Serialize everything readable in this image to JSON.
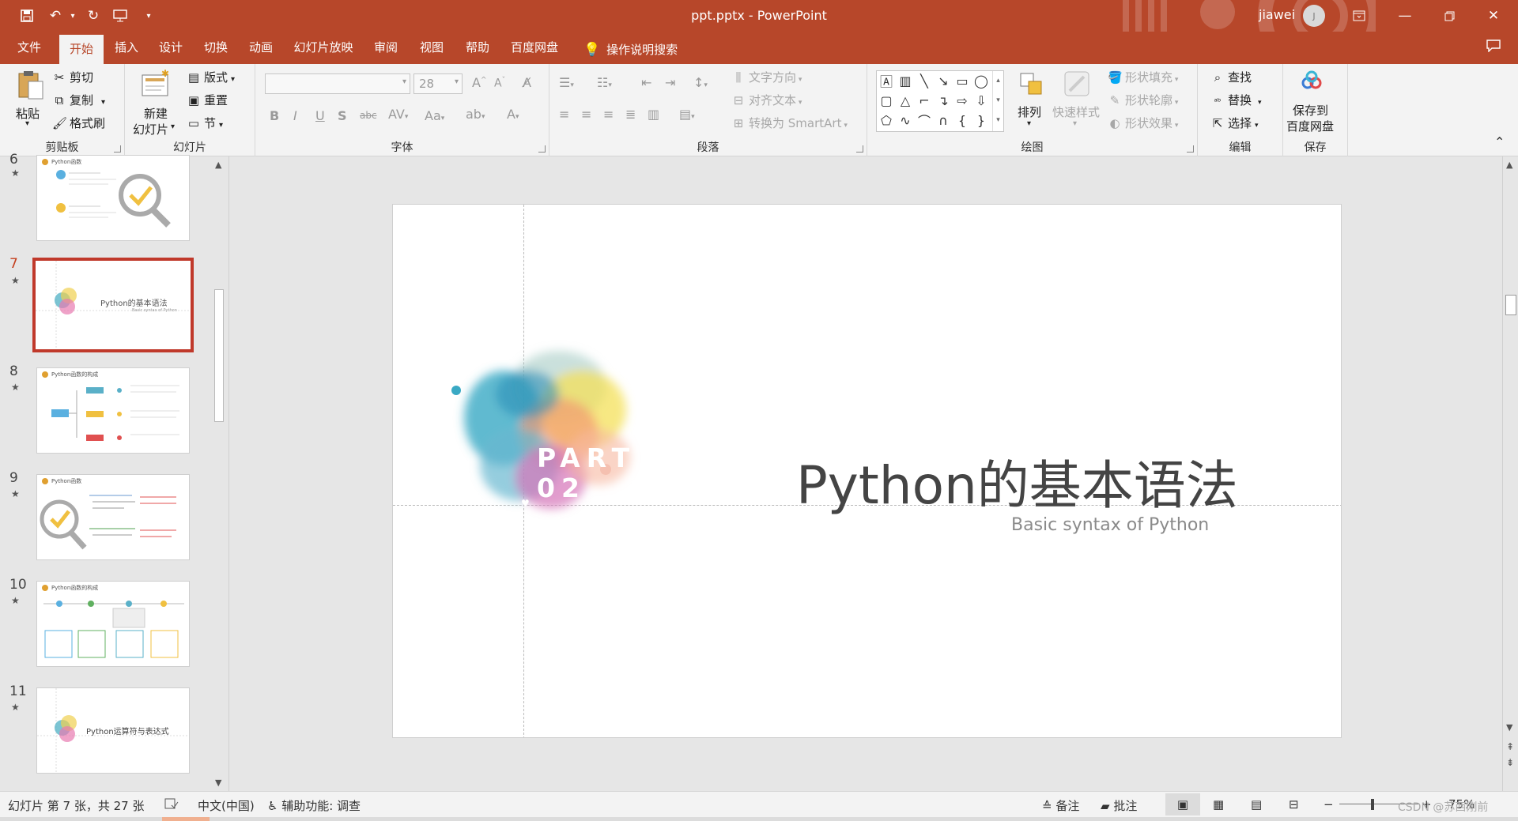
{
  "titlebar": {
    "document_title": "ppt.pptx  -  PowerPoint",
    "user_name": "jiawei",
    "avatar_initial": "J"
  },
  "menu": {
    "tabs": [
      "文件",
      "开始",
      "插入",
      "设计",
      "切换",
      "动画",
      "幻灯片放映",
      "审阅",
      "视图",
      "帮助",
      "百度网盘"
    ],
    "active_tab": "开始",
    "help_search": "操作说明搜索"
  },
  "ribbon": {
    "clipboard": {
      "label": "剪贴板",
      "paste": "粘贴",
      "cut": "剪切",
      "copy": "复制",
      "format_painter": "格式刷"
    },
    "slides": {
      "label": "幻灯片",
      "new_slide_line1": "新建",
      "new_slide_line2": "幻灯片",
      "layout": "版式",
      "reset": "重置",
      "section": "节"
    },
    "font": {
      "label": "字体",
      "font_name": "",
      "font_size": "28"
    },
    "paragraph": {
      "label": "段落",
      "text_direction": "文字方向",
      "align_text": "对齐文本",
      "convert_smartart": "转换为 SmartArt"
    },
    "drawing": {
      "label": "绘图",
      "arrange": "排列",
      "quick_styles": "快速样式",
      "shape_fill": "形状填充",
      "shape_outline": "形状轮廓",
      "shape_effects": "形状效果"
    },
    "editing": {
      "label": "编辑",
      "find": "查找",
      "replace": "替换",
      "select": "选择"
    },
    "save": {
      "label": "保存",
      "save_line1": "保存到",
      "save_line2": "百度网盘"
    }
  },
  "slides_pane": {
    "items": [
      {
        "num": "6",
        "title": "Python函数"
      },
      {
        "num": "7",
        "title": "Python的基本语法",
        "subtitle": "Basic syntax of Python",
        "selected": true
      },
      {
        "num": "8",
        "title": "Python函数的构成"
      },
      {
        "num": "9",
        "title": "Python函数"
      },
      {
        "num": "10",
        "title": "Python函数的构成"
      },
      {
        "num": "11",
        "title": "Python运算符与表达式"
      }
    ]
  },
  "slide": {
    "part_line1": "PART",
    "part_line2": "02",
    "title": "Python的基本语法",
    "subtitle": "Basic syntax of Python"
  },
  "statusbar": {
    "slide_info": "幻灯片 第 7 张，共 27 张",
    "language": "中文(中国)",
    "accessibility": "辅助功能: 调查",
    "notes": "备注",
    "comments": "批注",
    "zoom": "75%",
    "watermark": "CSDN @苏西刚前"
  }
}
